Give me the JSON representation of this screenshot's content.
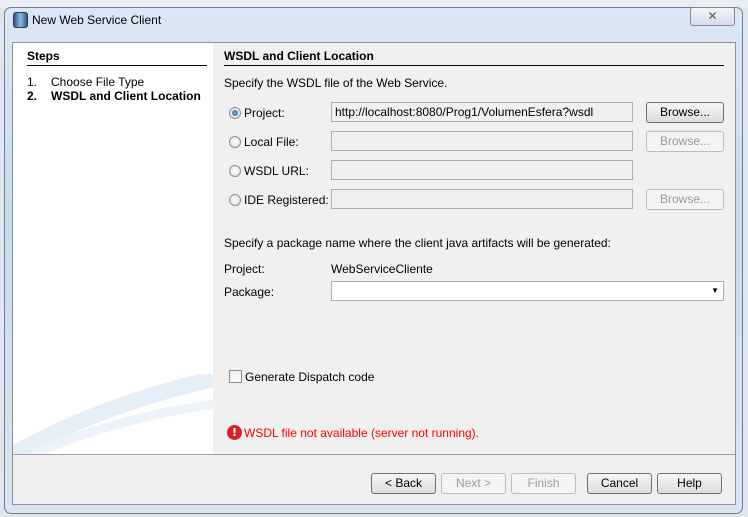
{
  "window": {
    "title": "New Web Service Client",
    "close_icon": "close-icon"
  },
  "steps": {
    "header": "Steps",
    "items": [
      {
        "num": "1.",
        "label": "Choose File Type"
      },
      {
        "num": "2.",
        "label": "WSDL and Client Location"
      }
    ]
  },
  "main": {
    "header": "WSDL and Client Location",
    "intro": "Specify the WSDL file of the Web Service.",
    "options": [
      {
        "label": "Project:",
        "value": "http://localhost:8080/Prog1/VolumenEsfera?wsdl",
        "selected": true,
        "browse": "Browse..."
      },
      {
        "label": "Local File:",
        "value": "",
        "selected": false,
        "browse": "Browse..."
      },
      {
        "label": "WSDL URL:",
        "value": "",
        "selected": false
      },
      {
        "label": "IDE Registered:",
        "value": "",
        "selected": false,
        "browse": "Browse..."
      }
    ],
    "package_intro": "Specify a package name where the client java artifacts will be generated:",
    "project_label": "Project:",
    "project_value": "WebServiceCliente",
    "package_label": "Package:",
    "package_value": "",
    "dispatch_label": "Generate Dispatch code",
    "dispatch_checked": false,
    "error": "WSDL file not available (server not running).",
    "error_color": "#ff0000"
  },
  "buttons": {
    "back": "< Back",
    "next": "Next >",
    "finish": "Finish",
    "cancel": "Cancel",
    "help": "Help"
  }
}
